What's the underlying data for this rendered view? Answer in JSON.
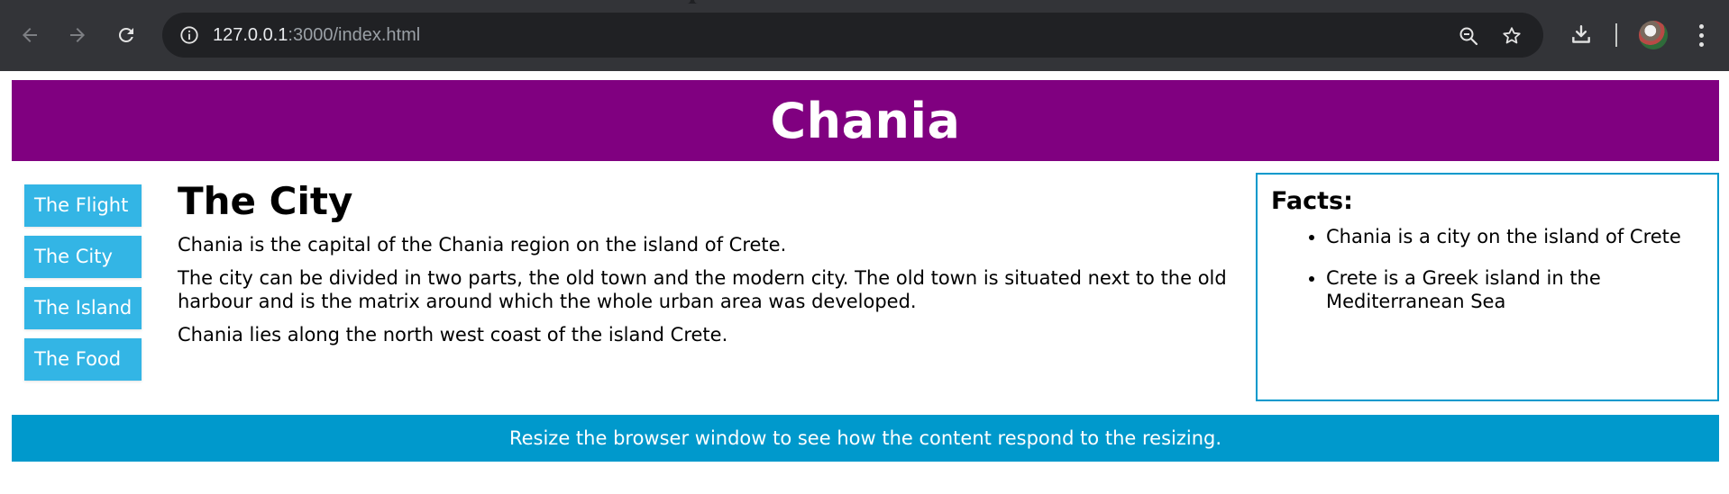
{
  "browser": {
    "url_host": "127.0.0.1",
    "url_rest": ":3000/index.html",
    "icons": {
      "back": "arrow-left-icon",
      "forward": "arrow-right-icon",
      "reload": "reload-icon",
      "site_info": "info-icon",
      "zoom": "zoom-out-icon",
      "bookmark": "star-icon",
      "download": "download-icon",
      "profile": "avatar",
      "menu": "kebab-menu-icon"
    }
  },
  "page": {
    "header": {
      "title": "Chania"
    },
    "menu": {
      "items": [
        {
          "label": "The Flight"
        },
        {
          "label": "The City"
        },
        {
          "label": "The Island"
        },
        {
          "label": "The Food"
        }
      ]
    },
    "main": {
      "heading": "The City",
      "paragraphs": [
        "Chania is the capital of the Chania region on the island of Crete.",
        "The city can be divided in two parts, the old town and the modern city. The old town is situated next to the old harbour and is the matrix around which the whole urban area was developed.",
        "Chania lies along the north west coast of the island Crete."
      ]
    },
    "aside": {
      "heading": "Facts:",
      "items": [
        "Chania is a city on the island of Crete",
        "Crete is a Greek island in the Mediterranean Sea"
      ]
    },
    "footer": {
      "text": "Resize the browser window to see how the content respond to the resizing."
    },
    "colors": {
      "header_bg": "#800080",
      "menu_item_bg": "#33b5e5",
      "aside_border": "#0099cc",
      "footer_bg": "#0099cc"
    }
  }
}
